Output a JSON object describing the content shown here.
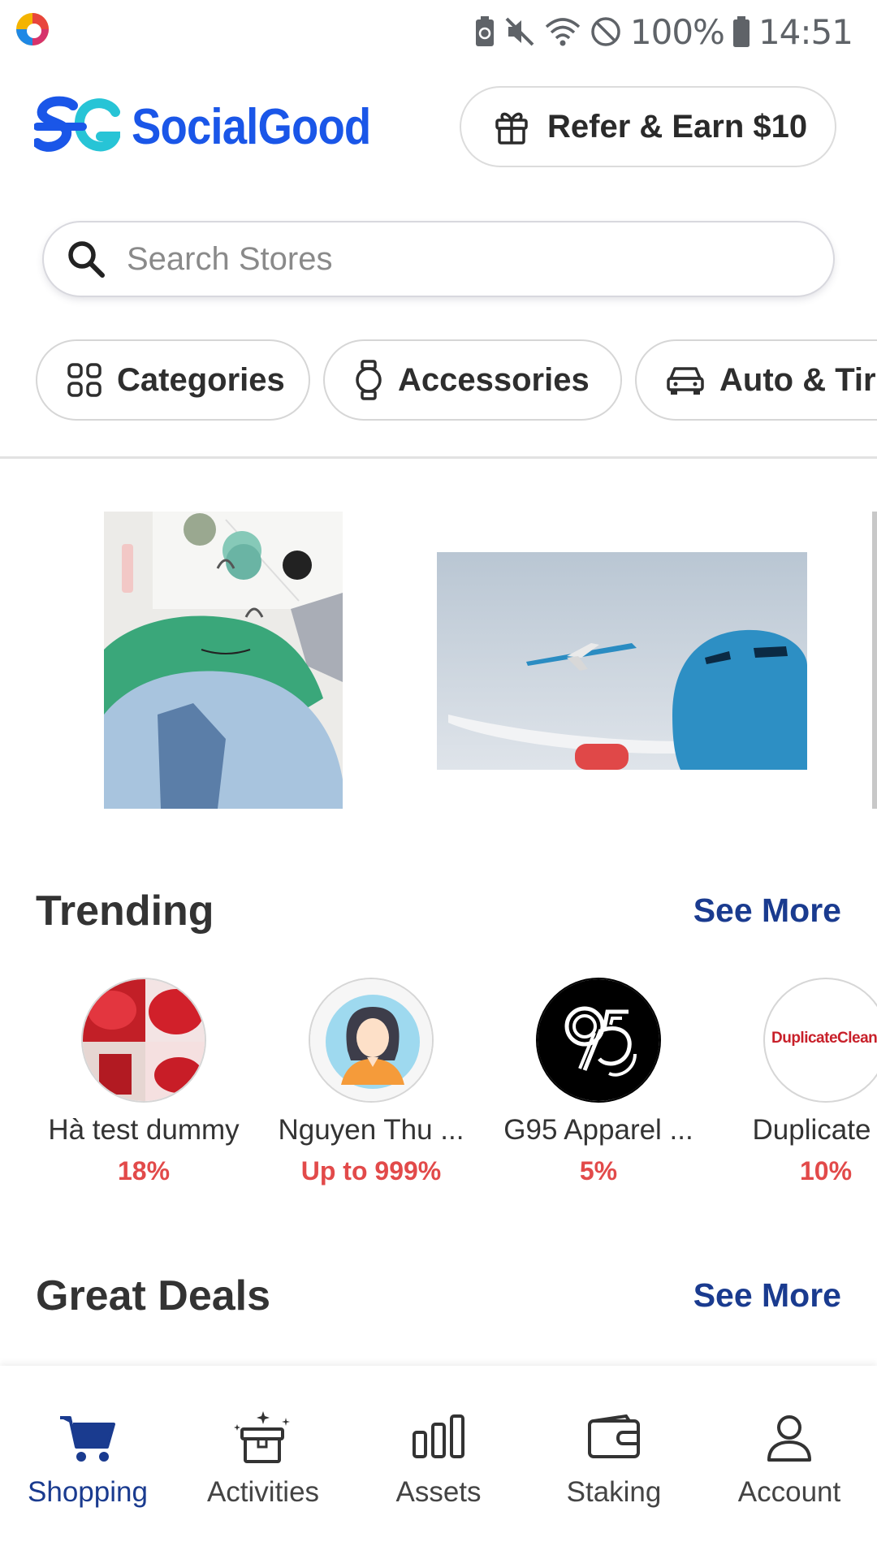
{
  "status_bar": {
    "battery": "100%",
    "time": "14:51"
  },
  "header": {
    "brand": "SocialGood",
    "refer_label": "Refer & Earn $10"
  },
  "search": {
    "placeholder": "Search Stores"
  },
  "chips": [
    {
      "label": "Categories",
      "icon": "grid-icon"
    },
    {
      "label": "Accessories",
      "icon": "watch-icon"
    },
    {
      "label": "Auto & Tire",
      "icon": "car-icon"
    }
  ],
  "banners": [
    {
      "icon": "clothing-banner"
    },
    {
      "icon": "airplane-banner"
    }
  ],
  "trending": {
    "title": "Trending",
    "see_more": "See More",
    "stores": [
      {
        "name": "Hà test dummy",
        "cashback": "18%"
      },
      {
        "name": "Nguyen Thu ...",
        "cashback": "Up to 999%"
      },
      {
        "name": "G95 Apparel ...",
        "cashback": "5%"
      },
      {
        "name": "Duplicate C",
        "cashback": "10%",
        "logo_text": "DuplicateCleaner"
      }
    ]
  },
  "great_deals": {
    "title": "Great Deals",
    "see_more": "See More"
  },
  "bottom_nav": [
    {
      "label": "Shopping",
      "icon": "cart-icon",
      "active": true
    },
    {
      "label": "Activities",
      "icon": "gift-box-icon",
      "active": false
    },
    {
      "label": "Assets",
      "icon": "bar-chart-icon",
      "active": false
    },
    {
      "label": "Staking",
      "icon": "wallet-icon",
      "active": false
    },
    {
      "label": "Account",
      "icon": "user-icon",
      "active": false
    }
  ],
  "colors": {
    "brand_blue": "#1a56e8",
    "nav_active": "#1a3b8f",
    "cashback_red": "#e24a4a"
  }
}
